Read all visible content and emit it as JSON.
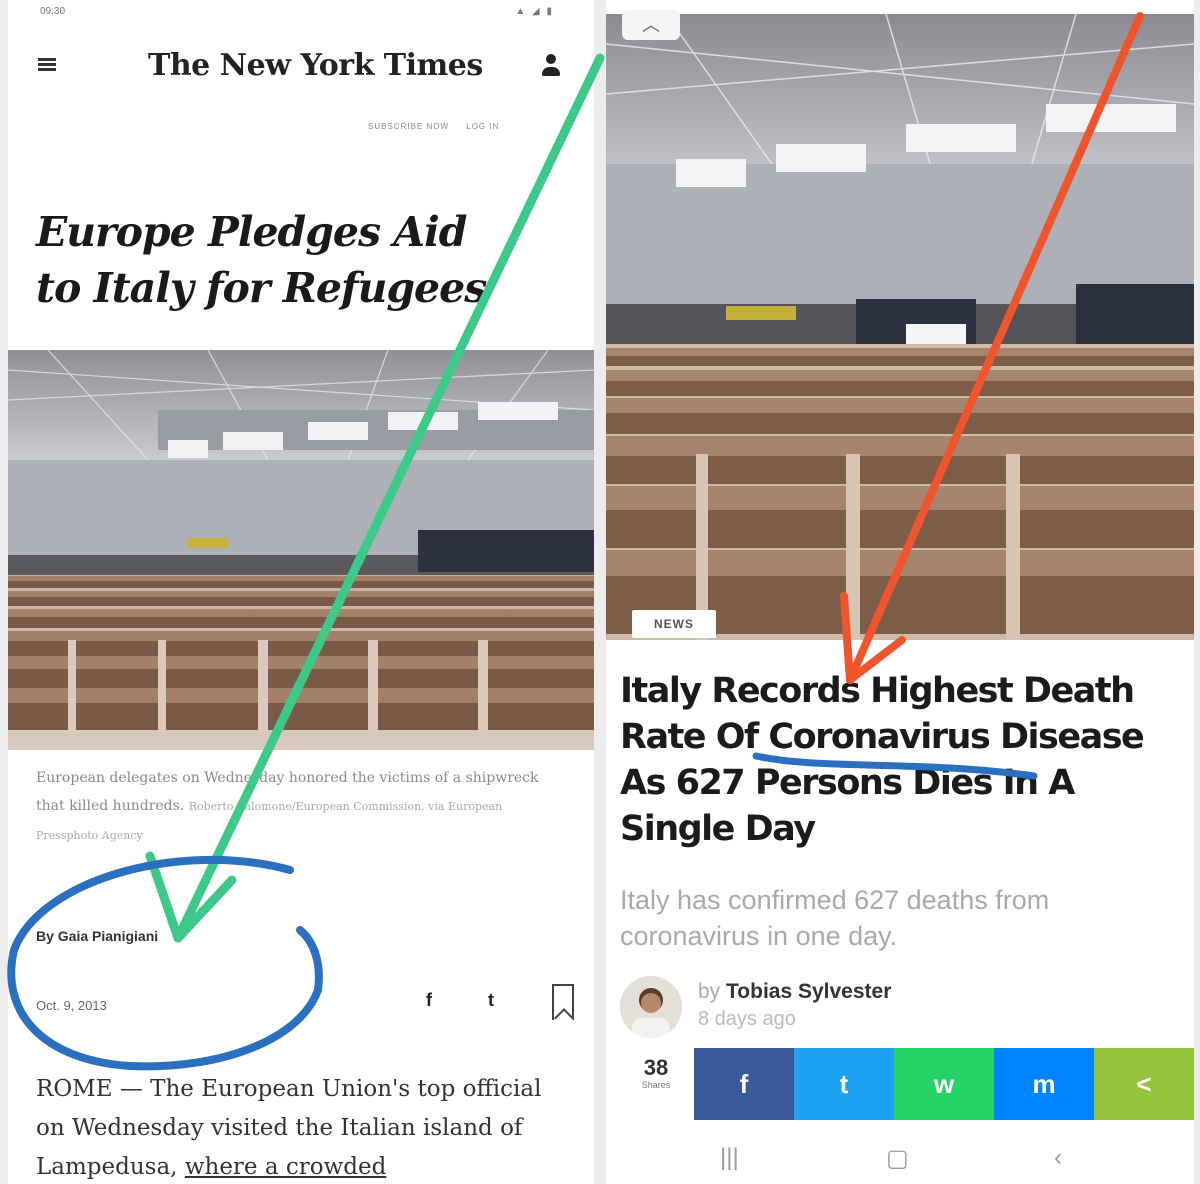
{
  "left_article": {
    "status_time": "09:30",
    "status_icons": "▲ ◢ ▮",
    "logo": "The New York Times",
    "subscribe": "SUBSCRIBE NOW",
    "login": "LOG IN",
    "title_line1": "Europe Pledges Aid",
    "title_line2": "to Italy for Refugees",
    "caption": "European delegates on Wednesday honored the victims of a shipwreck that killed hundreds.",
    "caption_credit": "Roberto Salomone/European Commission, via European Pressphoto Agency",
    "byline": "By Gaia Pianigiani",
    "date": "Oct. 9, 2013",
    "share_icons": [
      "f",
      "t"
    ],
    "body_prefix": "ROME — The European Union's top official on Wednesday visited the Italian island of Lampedusa, ",
    "body_link": "where a crowded"
  },
  "right_article": {
    "badge": "NEWS",
    "headline": "Italy Records Highest Death Rate Of Coronavirus Disease As 627 Persons Dies In A Single Day",
    "summary": "Italy has confirmed 627 deaths from coronavirus in one day.",
    "author_prefix": "by",
    "author": "Tobias Sylvester",
    "time_ago": "8 days ago",
    "shares_count": "38",
    "shares_label": "Shares",
    "share_buttons": [
      {
        "icon": "f",
        "color": "#3b5998"
      },
      {
        "icon": "t",
        "color": "#1da1f2"
      },
      {
        "icon": "w",
        "color": "#25d366"
      },
      {
        "icon": "m",
        "color": "#0084ff"
      },
      {
        "icon": "<",
        "color": "#95c33b"
      }
    ],
    "nav": [
      "|||",
      "▢",
      "‹"
    ]
  },
  "annotations": {
    "green_arrow_color": "#3dc98a",
    "red_arrow_color": "#f0542c",
    "blue_marker_color": "#2b6fc0"
  }
}
